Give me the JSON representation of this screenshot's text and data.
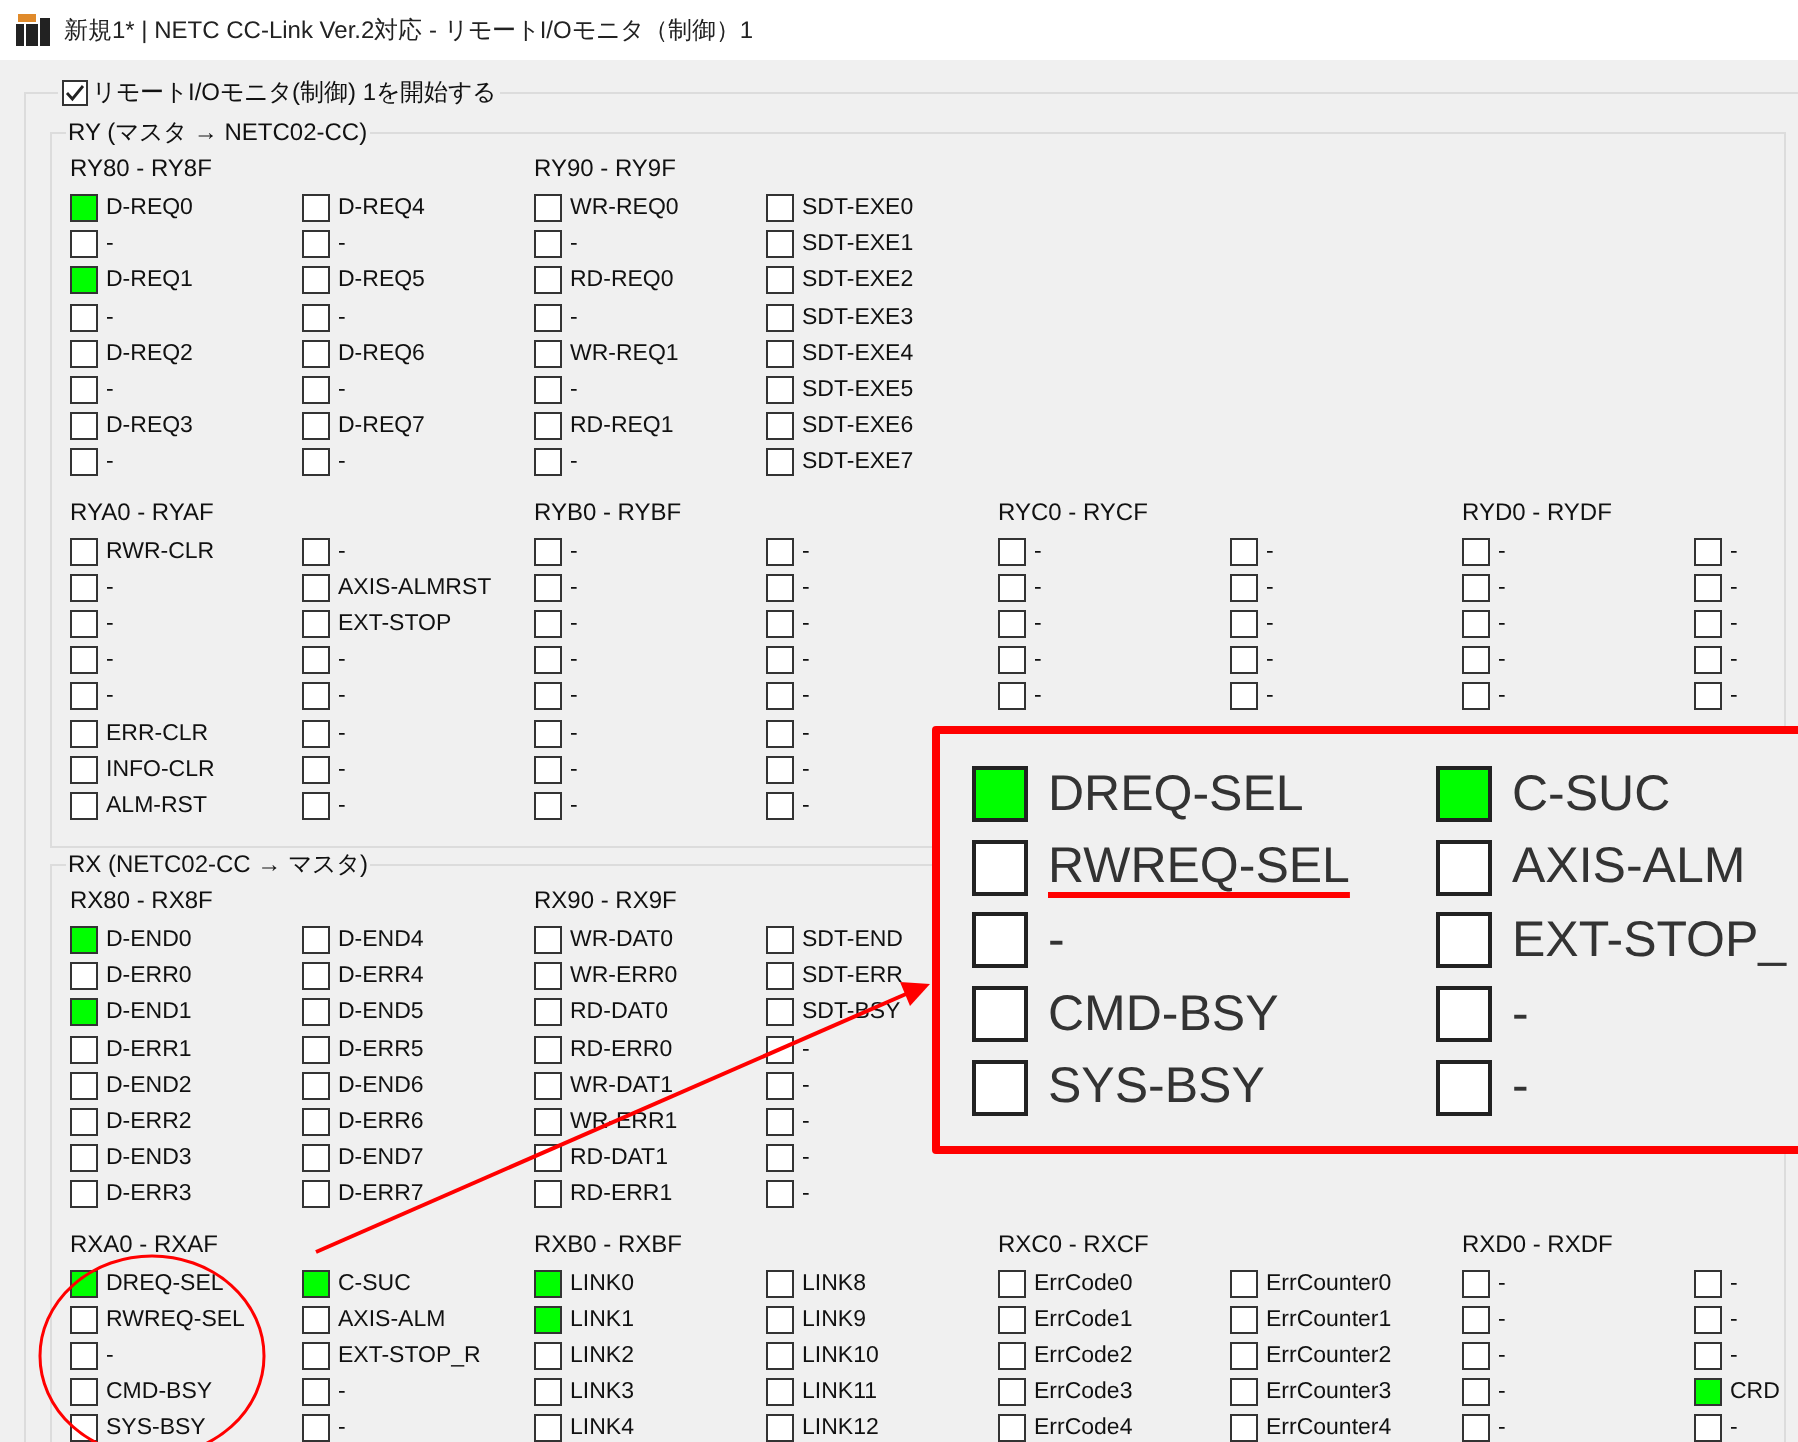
{
  "window": {
    "title": "新規1* | NETC CC-Link Ver.2対応 - リモートI/Oモニタ（制御）1"
  },
  "monitor_checkbox": {
    "label": "リモートI/Oモニタ(制御) 1を開始する",
    "checked": true
  },
  "groups": [
    {
      "title": "RY (マスタ → NETC02-CC)",
      "block_rows": [
        [
          {
            "title": "RY80 - RY8F",
            "columns": [
              [
                {
                  "label": "D-REQ0",
                  "on": true
                },
                {
                  "label": "-",
                  "on": false
                },
                {
                  "label": "D-REQ1",
                  "on": true
                },
                {
                  "label": "-",
                  "on": false
                },
                {
                  "label": "D-REQ2",
                  "on": false
                },
                {
                  "label": "-",
                  "on": false
                },
                {
                  "label": "D-REQ3",
                  "on": false
                },
                {
                  "label": "-",
                  "on": false
                }
              ],
              [
                {
                  "label": "D-REQ4",
                  "on": false
                },
                {
                  "label": "-",
                  "on": false
                },
                {
                  "label": "D-REQ5",
                  "on": false
                },
                {
                  "label": "-",
                  "on": false
                },
                {
                  "label": "D-REQ6",
                  "on": false
                },
                {
                  "label": "-",
                  "on": false
                },
                {
                  "label": "D-REQ7",
                  "on": false
                },
                {
                  "label": "-",
                  "on": false
                }
              ]
            ]
          },
          {
            "title": "RY90 - RY9F",
            "columns": [
              [
                {
                  "label": "WR-REQ0",
                  "on": false
                },
                {
                  "label": "-",
                  "on": false
                },
                {
                  "label": "RD-REQ0",
                  "on": false
                },
                {
                  "label": "-",
                  "on": false
                },
                {
                  "label": "WR-REQ1",
                  "on": false
                },
                {
                  "label": "-",
                  "on": false
                },
                {
                  "label": "RD-REQ1",
                  "on": false
                },
                {
                  "label": "-",
                  "on": false
                }
              ],
              [
                {
                  "label": "SDT-EXE0",
                  "on": false
                },
                {
                  "label": "SDT-EXE1",
                  "on": false
                },
                {
                  "label": "SDT-EXE2",
                  "on": false
                },
                {
                  "label": "SDT-EXE3",
                  "on": false
                },
                {
                  "label": "SDT-EXE4",
                  "on": false
                },
                {
                  "label": "SDT-EXE5",
                  "on": false
                },
                {
                  "label": "SDT-EXE6",
                  "on": false
                },
                {
                  "label": "SDT-EXE7",
                  "on": false
                }
              ]
            ]
          }
        ],
        [
          {
            "title": "RYA0 - RYAF",
            "columns": [
              [
                {
                  "label": "RWR-CLR",
                  "on": false
                },
                {
                  "label": "-",
                  "on": false
                },
                {
                  "label": "-",
                  "on": false
                },
                {
                  "label": "-",
                  "on": false
                },
                {
                  "label": "-",
                  "on": false
                },
                {
                  "label": "ERR-CLR",
                  "on": false
                },
                {
                  "label": "INFO-CLR",
                  "on": false
                },
                {
                  "label": "ALM-RST",
                  "on": false
                }
              ],
              [
                {
                  "label": "-",
                  "on": false
                },
                {
                  "label": "AXIS-ALMRST",
                  "on": false
                },
                {
                  "label": "EXT-STOP",
                  "on": false
                },
                {
                  "label": "-",
                  "on": false
                },
                {
                  "label": "-",
                  "on": false
                },
                {
                  "label": "-",
                  "on": false
                },
                {
                  "label": "-",
                  "on": false
                },
                {
                  "label": "-",
                  "on": false
                }
              ]
            ]
          },
          {
            "title": "RYB0 - RYBF",
            "columns": [
              [
                {
                  "label": "-",
                  "on": false
                },
                {
                  "label": "-",
                  "on": false
                },
                {
                  "label": "-",
                  "on": false
                },
                {
                  "label": "-",
                  "on": false
                },
                {
                  "label": "-",
                  "on": false
                },
                {
                  "label": "-",
                  "on": false
                },
                {
                  "label": "-",
                  "on": false
                },
                {
                  "label": "-",
                  "on": false
                }
              ],
              [
                {
                  "label": "-",
                  "on": false
                },
                {
                  "label": "-",
                  "on": false
                },
                {
                  "label": "-",
                  "on": false
                },
                {
                  "label": "-",
                  "on": false
                },
                {
                  "label": "-",
                  "on": false
                },
                {
                  "label": "-",
                  "on": false
                },
                {
                  "label": "-",
                  "on": false
                },
                {
                  "label": "-",
                  "on": false
                }
              ]
            ]
          },
          {
            "title": "RYC0 - RYCF",
            "columns": [
              [
                {
                  "label": "-",
                  "on": false
                },
                {
                  "label": "-",
                  "on": false
                },
                {
                  "label": "-",
                  "on": false
                },
                {
                  "label": "-",
                  "on": false
                },
                {
                  "label": "-",
                  "on": false
                }
              ],
              [
                {
                  "label": "-",
                  "on": false
                },
                {
                  "label": "-",
                  "on": false
                },
                {
                  "label": "-",
                  "on": false
                },
                {
                  "label": "-",
                  "on": false
                },
                {
                  "label": "-",
                  "on": false
                }
              ]
            ]
          },
          {
            "title": "RYD0 - RYDF",
            "columns": [
              [
                {
                  "label": "-",
                  "on": false
                },
                {
                  "label": "-",
                  "on": false
                },
                {
                  "label": "-",
                  "on": false
                },
                {
                  "label": "-",
                  "on": false
                },
                {
                  "label": "-",
                  "on": false
                }
              ],
              [
                {
                  "label": "-",
                  "on": false
                },
                {
                  "label": "-",
                  "on": false
                },
                {
                  "label": "-",
                  "on": false
                },
                {
                  "label": "-",
                  "on": false
                },
                {
                  "label": "-",
                  "on": false
                }
              ]
            ]
          }
        ]
      ]
    },
    {
      "title": "RX (NETC02-CC → マスタ)",
      "block_rows": [
        [
          {
            "title": "RX80 - RX8F",
            "columns": [
              [
                {
                  "label": "D-END0",
                  "on": true
                },
                {
                  "label": "D-ERR0",
                  "on": false
                },
                {
                  "label": "D-END1",
                  "on": true
                },
                {
                  "label": "D-ERR1",
                  "on": false
                },
                {
                  "label": "D-END2",
                  "on": false
                },
                {
                  "label": "D-ERR2",
                  "on": false
                },
                {
                  "label": "D-END3",
                  "on": false
                },
                {
                  "label": "D-ERR3",
                  "on": false
                }
              ],
              [
                {
                  "label": "D-END4",
                  "on": false
                },
                {
                  "label": "D-ERR4",
                  "on": false
                },
                {
                  "label": "D-END5",
                  "on": false
                },
                {
                  "label": "D-ERR5",
                  "on": false
                },
                {
                  "label": "D-END6",
                  "on": false
                },
                {
                  "label": "D-ERR6",
                  "on": false
                },
                {
                  "label": "D-END7",
                  "on": false
                },
                {
                  "label": "D-ERR7",
                  "on": false
                }
              ]
            ]
          },
          {
            "title": "RX90 - RX9F",
            "columns": [
              [
                {
                  "label": "WR-DAT0",
                  "on": false
                },
                {
                  "label": "WR-ERR0",
                  "on": false
                },
                {
                  "label": "RD-DAT0",
                  "on": false
                },
                {
                  "label": "RD-ERR0",
                  "on": false
                },
                {
                  "label": "WR-DAT1",
                  "on": false
                },
                {
                  "label": "WR-ERR1",
                  "on": false
                },
                {
                  "label": "RD-DAT1",
                  "on": false
                },
                {
                  "label": "RD-ERR1",
                  "on": false
                }
              ],
              [
                {
                  "label": "SDT-END",
                  "on": false
                },
                {
                  "label": "SDT-ERR",
                  "on": false
                },
                {
                  "label": "SDT-BSY",
                  "on": false
                },
                {
                  "label": "-",
                  "on": false
                },
                {
                  "label": "-",
                  "on": false
                },
                {
                  "label": "-",
                  "on": false
                },
                {
                  "label": "-",
                  "on": false
                },
                {
                  "label": "-",
                  "on": false
                }
              ]
            ]
          }
        ],
        [
          {
            "title": "RXA0 - RXAF",
            "columns": [
              [
                {
                  "label": "DREQ-SEL",
                  "on": true
                },
                {
                  "label": "RWREQ-SEL",
                  "on": false
                },
                {
                  "label": "-",
                  "on": false
                },
                {
                  "label": "CMD-BSY",
                  "on": false
                },
                {
                  "label": "SYS-BSY",
                  "on": false
                }
              ],
              [
                {
                  "label": "C-SUC",
                  "on": true
                },
                {
                  "label": "AXIS-ALM",
                  "on": false
                },
                {
                  "label": "EXT-STOP_R",
                  "on": false
                },
                {
                  "label": "-",
                  "on": false
                },
                {
                  "label": "-",
                  "on": false
                }
              ]
            ]
          },
          {
            "title": "RXB0 - RXBF",
            "columns": [
              [
                {
                  "label": "LINK0",
                  "on": true
                },
                {
                  "label": "LINK1",
                  "on": true
                },
                {
                  "label": "LINK2",
                  "on": false
                },
                {
                  "label": "LINK3",
                  "on": false
                },
                {
                  "label": "LINK4",
                  "on": false
                }
              ],
              [
                {
                  "label": "LINK8",
                  "on": false
                },
                {
                  "label": "LINK9",
                  "on": false
                },
                {
                  "label": "LINK10",
                  "on": false
                },
                {
                  "label": "LINK11",
                  "on": false
                },
                {
                  "label": "LINK12",
                  "on": false
                }
              ]
            ]
          },
          {
            "title": "RXC0 - RXCF",
            "columns": [
              [
                {
                  "label": "ErrCode0",
                  "on": false
                },
                {
                  "label": "ErrCode1",
                  "on": false
                },
                {
                  "label": "ErrCode2",
                  "on": false
                },
                {
                  "label": "ErrCode3",
                  "on": false
                },
                {
                  "label": "ErrCode4",
                  "on": false
                }
              ],
              [
                {
                  "label": "ErrCounter0",
                  "on": false
                },
                {
                  "label": "ErrCounter1",
                  "on": false
                },
                {
                  "label": "ErrCounter2",
                  "on": false
                },
                {
                  "label": "ErrCounter3",
                  "on": false
                },
                {
                  "label": "ErrCounter4",
                  "on": false
                }
              ]
            ]
          },
          {
            "title": "RXD0 - RXDF",
            "columns": [
              [
                {
                  "label": "-",
                  "on": false
                },
                {
                  "label": "-",
                  "on": false
                },
                {
                  "label": "-",
                  "on": false
                },
                {
                  "label": "-",
                  "on": false
                },
                {
                  "label": "-",
                  "on": false
                }
              ],
              [
                {
                  "label": "-",
                  "on": false
                },
                {
                  "label": "-",
                  "on": false
                },
                {
                  "label": "-",
                  "on": false
                },
                {
                  "label": "CRD",
                  "on": true
                },
                {
                  "label": "-",
                  "on": false
                }
              ]
            ]
          }
        ]
      ]
    }
  ],
  "callout": {
    "columns": [
      [
        {
          "label": "DREQ-SEL",
          "on": true,
          "underlined": false
        },
        {
          "label": "RWREQ-SEL",
          "on": false,
          "underlined": true
        },
        {
          "label": "-",
          "on": false,
          "underlined": false
        },
        {
          "label": "CMD-BSY",
          "on": false,
          "underlined": false
        },
        {
          "label": "SYS-BSY",
          "on": false,
          "underlined": false
        }
      ],
      [
        {
          "label": "C-SUC",
          "on": true,
          "underlined": false
        },
        {
          "label": "AXIS-ALM",
          "on": false,
          "underlined": false
        },
        {
          "label": "EXT-STOP_",
          "on": false,
          "underlined": false
        },
        {
          "label": "-",
          "on": false,
          "underlined": false
        },
        {
          "label": "-",
          "on": false,
          "underlined": false
        }
      ]
    ]
  }
}
